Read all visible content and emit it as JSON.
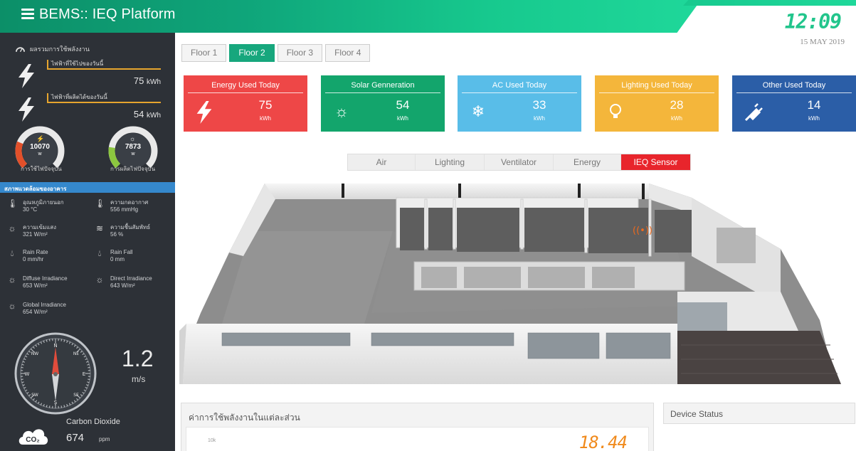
{
  "header": {
    "title": "BEMS:: IEQ Platform",
    "time": "12:09",
    "date": "15 MAY 2019"
  },
  "sidebar": {
    "energy_title": "ผลรวมการใช้พลังงาน",
    "rows": [
      {
        "label": "ไฟฟ้าที่ใช้ไปของวันนี้",
        "value": "75",
        "unit": "kWh"
      },
      {
        "label": "ไฟฟ้าที่ผลิตได้ของวันนี้",
        "value": "54",
        "unit": "kWh"
      }
    ],
    "gauges": [
      {
        "value": "10070",
        "unit": "w",
        "label": "การใช้ไฟปัจจุบัน",
        "color": "#e2502a",
        "fraction": 0.25
      },
      {
        "value": "7873",
        "unit": "w",
        "label": "การผลิตไฟปัจจุบัน",
        "color": "#8cc63f",
        "fraction": 0.2
      }
    ],
    "env_title": "สภาพแวดล้อมของอาคาร",
    "env": [
      {
        "icon": "thermometer-icon",
        "label": "อุณหภูมิภายนอก",
        "value": "30 °C"
      },
      {
        "icon": "thermometer-icon",
        "label": "ความกดอากาศ",
        "value": "556 mmHg"
      },
      {
        "icon": "sun-icon",
        "label": "ความเข้มแสง",
        "value": "321 W/m²"
      },
      {
        "icon": "humidity-icon",
        "label": "ความชื้นสัมพัทธ์",
        "value": "56 %"
      },
      {
        "icon": "raindrop-icon",
        "label": "Rain Rate",
        "value": "0 mm/hr"
      },
      {
        "icon": "raindrop-icon",
        "label": "Rain Fall",
        "value": "0 mm"
      },
      {
        "icon": "sun-icon",
        "label": "Diffuse Irradiance",
        "value": "653 W/m²"
      },
      {
        "icon": "sun-icon",
        "label": "Direct Irradiance",
        "value": "643 W/m²"
      },
      {
        "icon": "sun-icon",
        "label": "Global Irradiance",
        "value": "654 W/m²"
      }
    ],
    "compass_labels": {
      "n": "N",
      "s": "S",
      "e": "E",
      "w": "W",
      "ne": "NE",
      "nw": "NW",
      "se": "SE",
      "sw": "SW"
    },
    "wind_speed": "1.2",
    "wind_unit": "m/s",
    "co2_icon": "CO₂",
    "co2_label": "Carbon Dioxide",
    "co2_value": "674",
    "co2_unit": "ppm"
  },
  "floors": [
    "Floor 1",
    "Floor 2",
    "Floor 3",
    "Floor 4"
  ],
  "active_floor": "Floor 2",
  "cards": [
    {
      "title": "Energy Used Today",
      "value": "75",
      "unit": "kWh",
      "color": "#ee4747",
      "icon": "lightning-icon"
    },
    {
      "title": "Solar Genneration",
      "value": "54",
      "unit": "kWh",
      "color": "#13a56c",
      "icon": "sun-icon"
    },
    {
      "title": "AC Used Today",
      "value": "33",
      "unit": "kWh",
      "color": "#59bde8",
      "icon": "snowflake-icon"
    },
    {
      "title": "Lighting Used Today",
      "value": "28",
      "unit": "kWh",
      "color": "#f4b63b",
      "icon": "lightbulb-icon"
    },
    {
      "title": "Other Used Today",
      "value": "14",
      "unit": "kWh",
      "color": "#2b5ea7",
      "icon": "plug-icon"
    }
  ],
  "sensor_tabs": [
    "Air",
    "Lighting",
    "Ventilator",
    "Energy",
    "IEQ Sensor"
  ],
  "active_sensor_tab": "IEQ Sensor",
  "energy_panel": {
    "title": "ค่าการใช้พลังงานในแต่ละส่วน",
    "y_tick": "10k",
    "value": "18.44"
  },
  "status_panel": {
    "title": "Device Status"
  }
}
